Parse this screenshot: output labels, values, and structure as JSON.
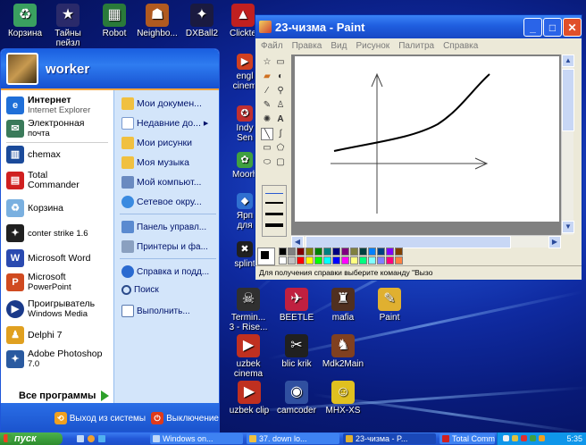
{
  "desktop": {
    "top_icons": [
      {
        "label": "Корзина",
        "icon": "recycle-bin-icon"
      },
      {
        "label": "Тайны пейзл",
        "icon": "game-icon"
      },
      {
        "label": "Robot",
        "icon": "robot-icon"
      },
      {
        "label": "Neighbo...",
        "icon": "game-icon"
      },
      {
        "label": "DXBall2",
        "icon": "game-icon"
      },
      {
        "label": "Clickte",
        "icon": "app-icon"
      }
    ],
    "side_icons": [
      {
        "label": "engl cinem",
        "icon": "app-icon"
      },
      {
        "label": "Indy Sen",
        "icon": "app-icon"
      },
      {
        "label": "Moorh",
        "icon": "app-icon"
      },
      {
        "label": "Ярп для",
        "icon": "app-icon"
      },
      {
        "label": "splint",
        "icon": "app-icon"
      }
    ],
    "grid_icons": [
      {
        "label": "Termin... 3 - Rise...",
        "icon": "game-icon"
      },
      {
        "label": "BEETLE",
        "icon": "game-icon"
      },
      {
        "label": "mafia",
        "icon": "game-icon"
      },
      {
        "label": "Paint",
        "icon": "paint-icon"
      },
      {
        "label": "uzbek cinema",
        "icon": "app-icon"
      },
      {
        "label": "blic krik",
        "icon": "app-icon"
      },
      {
        "label": "Mdk2Main",
        "icon": "game-icon"
      },
      {
        "label": "uzbek clip",
        "icon": "app-icon"
      },
      {
        "label": "camcoder",
        "icon": "app-icon"
      },
      {
        "label": "MHX-XS",
        "icon": "game-icon"
      }
    ]
  },
  "start_menu": {
    "user": "worker",
    "pinned": [
      {
        "title": "Интернет",
        "sub": "Internet Explorer"
      },
      {
        "title": "Электронная",
        "sub": "почта"
      }
    ],
    "recent": [
      {
        "title": "chemax"
      },
      {
        "title": "Total",
        "sub": "Commander"
      },
      {
        "title": "Корзина"
      },
      {
        "title": "conter strike  1.6"
      },
      {
        "title": "Microsoft Word"
      },
      {
        "title": "Microsoft",
        "sub": "PowerPoint"
      },
      {
        "title": "Проигрыватель",
        "sub": "Windows Media"
      },
      {
        "title": "Delphi 7"
      },
      {
        "title": "Adobe Photoshop",
        "sub": "7.0"
      }
    ],
    "all_programs": "Все программы",
    "right_items": [
      "Мои докумен...",
      "Недавние до...",
      "Мои рисунки",
      "Моя музыка",
      "Мой компьют...",
      "Сетевое окру...",
      "Панель управл...",
      "Принтеры и фа...",
      "Справка и подд...",
      "Поиск",
      "Выполнить..."
    ],
    "logoff": "Выход из системы",
    "shutdown": "Выключение"
  },
  "paint": {
    "title": "23-чизма - Paint",
    "menu": [
      "Файл",
      "Правка",
      "Вид",
      "Рисунок",
      "Палитра",
      "Справка"
    ],
    "status": "Для получения справки выберите команду \"Вызо"
  },
  "taskbar": {
    "start_label": "пуск",
    "tasks": [
      "Windows on...",
      "37. down lo...",
      "23-чизма - P...",
      "Total Comm..."
    ],
    "clock": "5:35"
  },
  "colors": {
    "palette": [
      "#000000",
      "#808080",
      "#800000",
      "#808000",
      "#008000",
      "#008080",
      "#000080",
      "#800080",
      "#808040",
      "#004040",
      "#0080ff",
      "#004080",
      "#8000ff",
      "#804000",
      "#ffffff",
      "#c0c0c0",
      "#ff0000",
      "#ffff00",
      "#00ff00",
      "#00ffff",
      "#0000ff",
      "#ff00ff",
      "#ffff80",
      "#00ff80",
      "#80ffff",
      "#8080ff",
      "#ff0080",
      "#ff8040"
    ]
  }
}
